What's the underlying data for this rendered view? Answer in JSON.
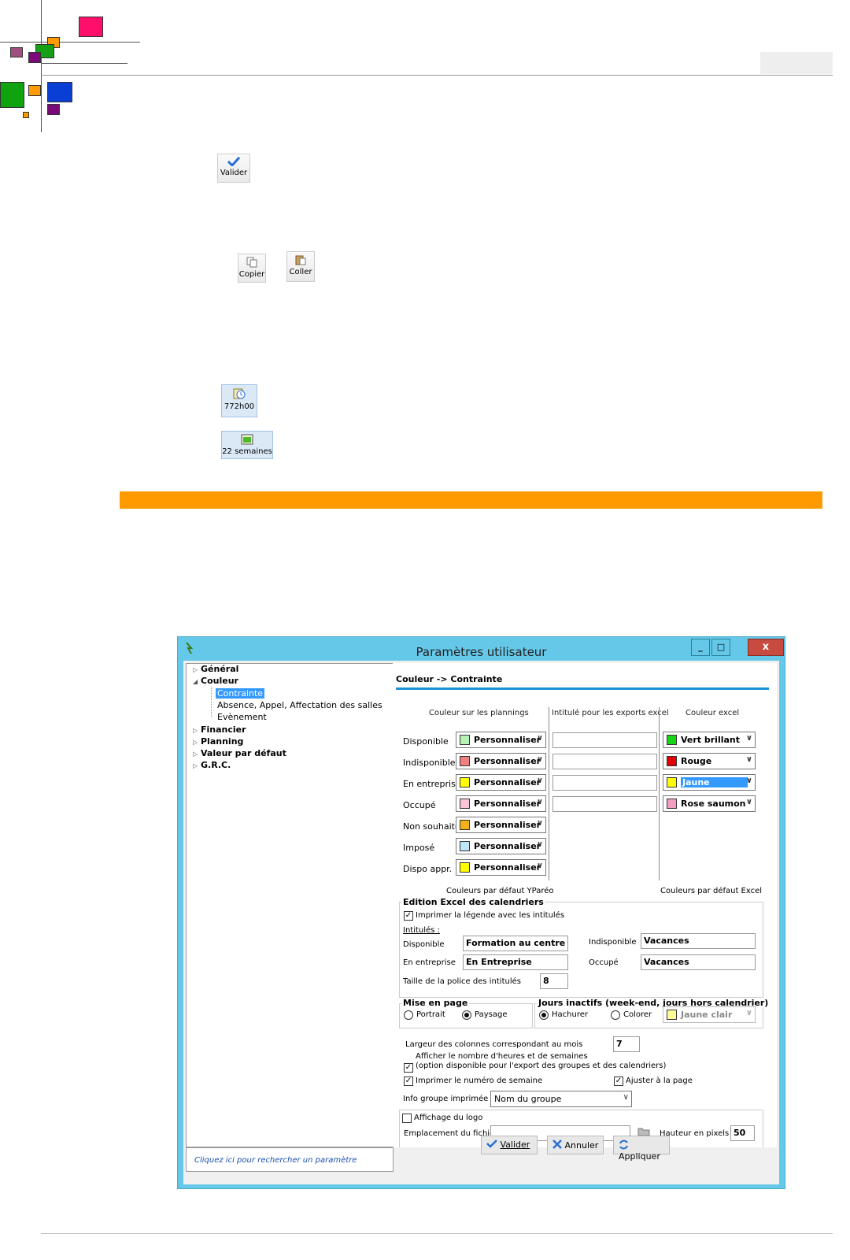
{
  "page": {
    "tab_label": "",
    "buttons": {
      "valider": "Valider",
      "copier": "Copier",
      "coller": "Coller",
      "hours": "772h00",
      "weeks": "22 semaines"
    }
  },
  "colors": {
    "orange_bar": "#ff9a00",
    "window_frame": "#66c8e8",
    "selection": "#3399ff",
    "accent_line": "#1e90d8"
  },
  "window": {
    "title": "Paramètres utilisateur",
    "close_label": "x",
    "tree": {
      "items": [
        {
          "label": "Général",
          "expanded": false
        },
        {
          "label": "Couleur",
          "expanded": true
        },
        {
          "label": "Contrainte",
          "selected": true
        },
        {
          "label": "Absence, Appel, Affectation des salles"
        },
        {
          "label": "Evènement"
        },
        {
          "label": "Financier",
          "expanded": false
        },
        {
          "label": "Planning",
          "expanded": false
        },
        {
          "label": "Valeur par défaut",
          "expanded": false
        },
        {
          "label": "G.R.C.",
          "expanded": false
        }
      ]
    },
    "search_hint": "Cliquez ici pour rechercher un paramètre",
    "panel": {
      "header": "Couleur -> Contrainte",
      "col_headers": {
        "plannings": "Couleur sur les plannings",
        "exports": "Intitulé pour les exports excel",
        "excel": "Couleur excel"
      },
      "rows": [
        {
          "label": "Disponible",
          "planning": "Personnaliser",
          "planning_color": "#b6f2b6",
          "excel": "Vert brillant",
          "excel_color": "#18d418"
        },
        {
          "label": "Indisponible",
          "planning": "Personnaliser",
          "planning_color": "#f08080",
          "excel": "Rouge",
          "excel_color": "#e00000"
        },
        {
          "label": "En entreprise",
          "planning": "Personnaliser",
          "planning_color": "#ffff00",
          "excel": "Jaune",
          "excel_color": "#ffff00"
        },
        {
          "label": "Occupé",
          "planning": "Personnaliser",
          "planning_color": "#f6c6d8",
          "excel": "Rose saumon",
          "excel_color": "#f19ec0"
        },
        {
          "label": "Non souhaité",
          "planning": "Personnaliser",
          "planning_color": "#f2b118"
        },
        {
          "label": "Imposé",
          "planning": "Personnaliser",
          "planning_color": "#bfe6f6"
        },
        {
          "label": "Dispo appr.",
          "planning": "Personnaliser",
          "planning_color": "#ffff00"
        }
      ],
      "default_yp": "Couleurs par défaut YParéo",
      "default_excel": "Couleurs par défaut Excel",
      "edition": {
        "title": "Edition Excel des calendriers",
        "print_legend": "Imprimer la légende avec les intitulés",
        "intitules_label": "Intitulés :",
        "disponible_label": "Disponible",
        "disponible_value": "Formation au centre",
        "indisponible_label": "Indisponible",
        "indisponible_value": "Vacances",
        "entreprise_label": "En entreprise",
        "entreprise_value": "En Entreprise",
        "occupe_label": "Occupé",
        "occupe_value": "Vacances",
        "font_size_label": "Taille de la police des intitulés",
        "font_size_value": "8"
      },
      "mise_en_page": {
        "title": "Mise en page",
        "portrait": "Portrait",
        "paysage": "Paysage",
        "selected": "Paysage"
      },
      "jours_inactifs": {
        "title": "Jours inactifs (week-end, jours hors calendrier)",
        "hachurer": "Hachurer",
        "colorer": "Colorer",
        "selected": "Hachurer",
        "color_label": "Jaune clair",
        "color": "#ffff99"
      },
      "column_width_label": "Largeur des colonnes correspondant au mois",
      "column_width_value": "7",
      "show_hours_line1": "Afficher le nombre d'heures et de semaines",
      "show_hours_line2": "(option disponible pour l'export des groupes et des calendriers)",
      "print_week": "Imprimer le numéro de semaine",
      "fit_page": "Ajuster à la page",
      "group_info_label": "Info groupe imprimée",
      "group_info_value": "Nom du groupe",
      "logo_label": "Affichage du logo",
      "file_location_label": "Emplacement du fichier",
      "height_label": "Hauteur en pixels",
      "height_value": "50"
    },
    "footer": {
      "valider": "Valider",
      "annuler": "Annuler",
      "appliquer": "Appliquer"
    }
  }
}
